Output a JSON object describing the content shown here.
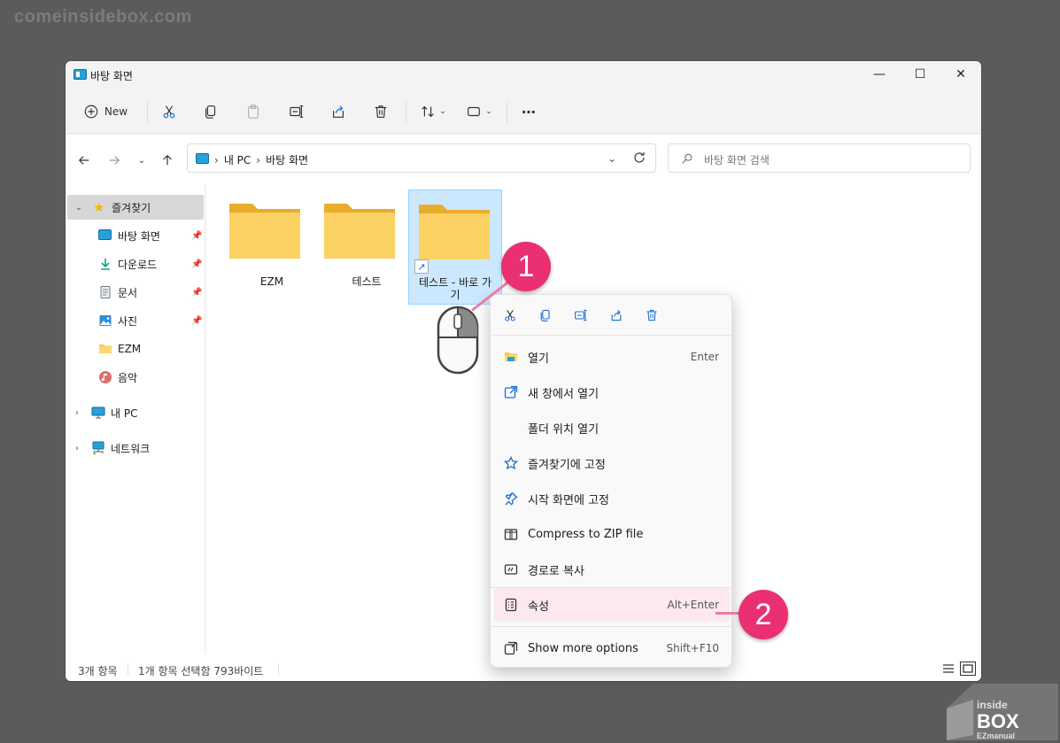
{
  "watermark": "comeinsidebox.com",
  "window": {
    "title": "바탕 화면",
    "controls": {
      "minimize": "—",
      "maximize": "☐",
      "close": "✕"
    }
  },
  "toolbar": {
    "new_label": "New"
  },
  "address": {
    "crumbs": [
      "내 PC",
      "바탕 화면"
    ],
    "search_placeholder": "바탕 화면 검색"
  },
  "sidebar": {
    "quick_access": "즐겨찾기",
    "items": [
      {
        "label": "바탕 화면",
        "icon": "desktop-icon"
      },
      {
        "label": "다운로드",
        "icon": "download-icon"
      },
      {
        "label": "문서",
        "icon": "document-icon"
      },
      {
        "label": "사진",
        "icon": "pictures-icon"
      },
      {
        "label": "EZM",
        "icon": "folder-icon"
      },
      {
        "label": "음악",
        "icon": "music-icon"
      }
    ],
    "this_pc": "내 PC",
    "network": "네트워크"
  },
  "files": [
    {
      "name": "EZM"
    },
    {
      "name": "테스트"
    },
    {
      "name": "테스트 - 바로 가기"
    }
  ],
  "status": {
    "count": "3개 항목",
    "selection": "1개 항목 선택함 793바이트"
  },
  "context_menu": {
    "items": [
      {
        "label": "열기",
        "shortcut": "Enter"
      },
      {
        "label": "새 창에서 열기",
        "shortcut": ""
      },
      {
        "label": "폴더 위치 열기",
        "shortcut": ""
      },
      {
        "label": "즐겨찾기에 고정",
        "shortcut": ""
      },
      {
        "label": "시작 화면에 고정",
        "shortcut": ""
      },
      {
        "label": "Compress to ZIP file",
        "shortcut": ""
      },
      {
        "label": "경로로 복사",
        "shortcut": ""
      },
      {
        "label": "속성",
        "shortcut": "Alt+Enter"
      },
      {
        "label": "Show more options",
        "shortcut": "Shift+F10"
      }
    ]
  },
  "annotations": {
    "step1": "1",
    "step2": "2"
  },
  "logo": {
    "line1": "inside",
    "line2": "BOX",
    "line3": "EZmanual"
  },
  "colors": {
    "badge": "#ea2f73",
    "selection": "#cce8ff",
    "folder": "#f8c94c",
    "accent": "#1a6fd1"
  }
}
